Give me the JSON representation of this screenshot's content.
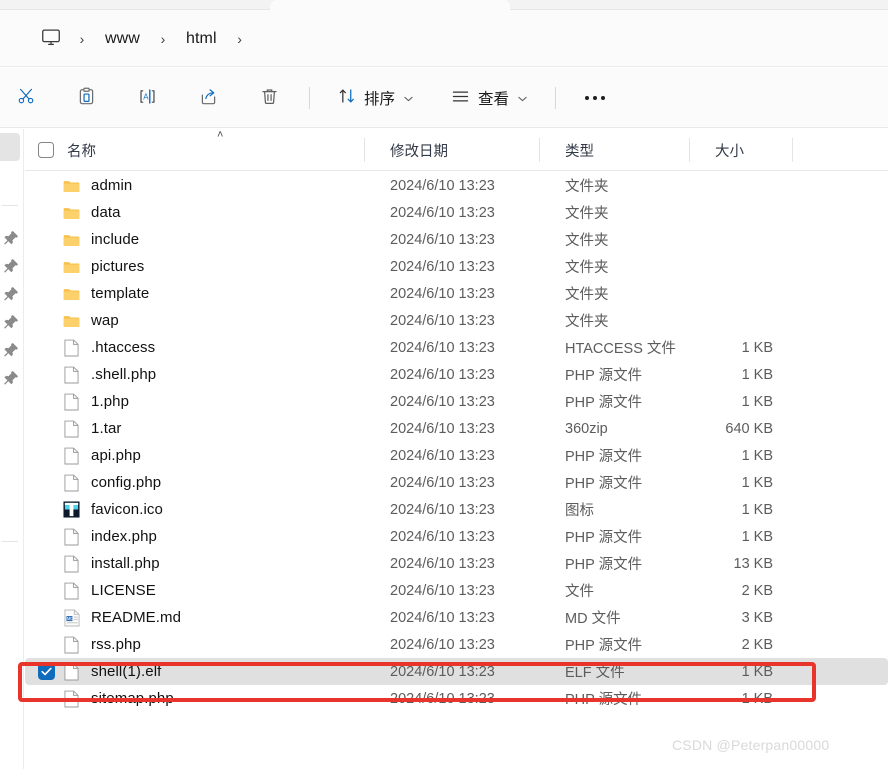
{
  "window": {
    "tab_title": ""
  },
  "breadcrumb": {
    "home_icon": "monitor-icon",
    "separator": "›",
    "items": [
      {
        "label": "www"
      },
      {
        "label": "html"
      }
    ],
    "trailing_separator": "›"
  },
  "toolbar": {
    "buttons": [
      {
        "name": "cut-button",
        "icon": "scissors-icon",
        "label": ""
      },
      {
        "name": "paste-button",
        "icon": "clipboard-icon",
        "label": ""
      },
      {
        "name": "rename-button",
        "icon": "rename-icon",
        "label": ""
      },
      {
        "name": "share-button",
        "icon": "share-icon",
        "label": ""
      },
      {
        "name": "delete-button",
        "icon": "trash-icon",
        "label": ""
      }
    ],
    "sort": {
      "label": "排序",
      "icon": "sort-arrows-icon",
      "chevron": "⌄"
    },
    "view": {
      "label": "查看",
      "icon": "list-lines-icon",
      "chevron": "⌄"
    },
    "overflow": {
      "label": "…",
      "name": "see-more-button"
    }
  },
  "columns": {
    "name": "名称",
    "date_modified": "修改日期",
    "type": "类型",
    "size": "大小",
    "sort_indicator": "˄"
  },
  "files": [
    {
      "name": "admin",
      "icon": "folder-icon",
      "date": "2024/6/10 13:23",
      "type": "文件夹",
      "size": "",
      "selected": false
    },
    {
      "name": "data",
      "icon": "folder-icon",
      "date": "2024/6/10 13:23",
      "type": "文件夹",
      "size": "",
      "selected": false
    },
    {
      "name": "include",
      "icon": "folder-icon",
      "date": "2024/6/10 13:23",
      "type": "文件夹",
      "size": "",
      "selected": false
    },
    {
      "name": "pictures",
      "icon": "folder-icon",
      "date": "2024/6/10 13:23",
      "type": "文件夹",
      "size": "",
      "selected": false
    },
    {
      "name": "template",
      "icon": "folder-icon",
      "date": "2024/6/10 13:23",
      "type": "文件夹",
      "size": "",
      "selected": false
    },
    {
      "name": "wap",
      "icon": "folder-icon",
      "date": "2024/6/10 13:23",
      "type": "文件夹",
      "size": "",
      "selected": false
    },
    {
      "name": ".htaccess",
      "icon": "file-icon",
      "date": "2024/6/10 13:23",
      "type": "HTACCESS 文件",
      "size": "1 KB",
      "selected": false
    },
    {
      "name": ".shell.php",
      "icon": "file-icon",
      "date": "2024/6/10 13:23",
      "type": "PHP 源文件",
      "size": "1 KB",
      "selected": false
    },
    {
      "name": "1.php",
      "icon": "file-icon",
      "date": "2024/6/10 13:23",
      "type": "PHP 源文件",
      "size": "1 KB",
      "selected": false
    },
    {
      "name": "1.tar",
      "icon": "file-icon",
      "date": "2024/6/10 13:23",
      "type": "360zip",
      "size": "640 KB",
      "selected": false
    },
    {
      "name": "api.php",
      "icon": "file-icon",
      "date": "2024/6/10 13:23",
      "type": "PHP 源文件",
      "size": "1 KB",
      "selected": false
    },
    {
      "name": "config.php",
      "icon": "file-icon",
      "date": "2024/6/10 13:23",
      "type": "PHP 源文件",
      "size": "1 KB",
      "selected": false
    },
    {
      "name": "favicon.ico",
      "icon": "favicon-icon",
      "date": "2024/6/10 13:23",
      "type": "图标",
      "size": "1 KB",
      "selected": false
    },
    {
      "name": "index.php",
      "icon": "file-icon",
      "date": "2024/6/10 13:23",
      "type": "PHP 源文件",
      "size": "1 KB",
      "selected": false
    },
    {
      "name": "install.php",
      "icon": "file-icon",
      "date": "2024/6/10 13:23",
      "type": "PHP 源文件",
      "size": "13 KB",
      "selected": false
    },
    {
      "name": "LICENSE",
      "icon": "file-icon",
      "date": "2024/6/10 13:23",
      "type": "文件",
      "size": "2 KB",
      "selected": false
    },
    {
      "name": "README.md",
      "icon": "markdown-icon",
      "date": "2024/6/10 13:23",
      "type": "MD 文件",
      "size": "3 KB",
      "selected": false
    },
    {
      "name": "rss.php",
      "icon": "file-icon",
      "date": "2024/6/10 13:23",
      "type": "PHP 源文件",
      "size": "2 KB",
      "selected": false
    },
    {
      "name": "shell(1).elf",
      "icon": "file-icon",
      "date": "2024/6/10 13:23",
      "type": "ELF 文件",
      "size": "1 KB",
      "selected": true
    },
    {
      "name": "sitemap.php",
      "icon": "file-icon",
      "date": "2024/6/10 13:23",
      "type": "PHP 源文件",
      "size": "1 KB",
      "selected": false
    }
  ],
  "annotation": {
    "highlight_color": "#e8342a",
    "target_row_name": "shell(1).elf"
  },
  "watermark": {
    "text": "CSDN @Peterpan00000"
  },
  "navpane": {
    "pinned_count": 6
  }
}
